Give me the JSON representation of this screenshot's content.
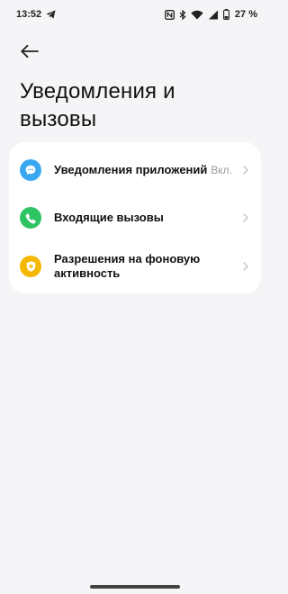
{
  "status_bar": {
    "time": "13:52",
    "battery_percent": "27 %",
    "icons": [
      "telegram-icon",
      "nfc-icon",
      "bluetooth-icon",
      "wifi-icon",
      "signal-icon",
      "battery-icon"
    ]
  },
  "header": {
    "back_icon": "arrow-left-icon",
    "title": "Уведомления и вызовы"
  },
  "settings": {
    "items": [
      {
        "label": "Уведомления приложений",
        "value": "Вкл.",
        "icon": "message-bubble-icon",
        "icon_color": "#3aa8f0"
      },
      {
        "label": "Входящие вызовы",
        "value": "",
        "icon": "phone-icon",
        "icon_color": "#2fc463"
      },
      {
        "label": "Разрешения на фоновую активность",
        "value": "",
        "icon": "shield-icon",
        "icon_color": "#f5b800"
      }
    ]
  },
  "colors": {
    "background": "#f5f5f7",
    "card": "#ffffff",
    "secondary_text": "#9a9a9a"
  }
}
